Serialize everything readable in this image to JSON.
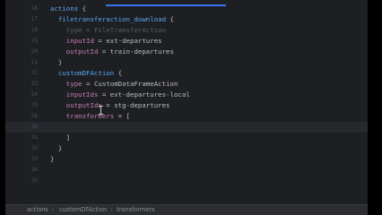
{
  "editor": {
    "lines": [
      {
        "num": "16",
        "indent": 0,
        "tokens": [
          {
            "t": "actions",
            "c": "prop"
          },
          {
            "t": " {",
            "c": "plain"
          }
        ]
      },
      {
        "num": "17",
        "indent": 1,
        "tokens": [
          {
            "t": "filetransferaction_download",
            "c": "prop"
          },
          {
            "t": " {",
            "c": "plain"
          }
        ]
      },
      {
        "num": "18",
        "indent": 2,
        "tokens": [
          {
            "t": "type = FileTransferAction",
            "c": "ghost"
          }
        ]
      },
      {
        "num": "19",
        "indent": 2,
        "tokens": [
          {
            "t": "inputId",
            "c": "key"
          },
          {
            "t": " = ext-departures",
            "c": "plain"
          }
        ]
      },
      {
        "num": "20",
        "indent": 2,
        "tokens": [
          {
            "t": "outputId",
            "c": "key"
          },
          {
            "t": " = train-departures",
            "c": "plain"
          }
        ]
      },
      {
        "num": "21",
        "indent": 1,
        "tokens": [
          {
            "t": "}",
            "c": "plain"
          }
        ]
      },
      {
        "num": "22",
        "indent": 1,
        "tokens": [
          {
            "t": "customDFAction",
            "c": "prop"
          },
          {
            "t": " {",
            "c": "plain"
          }
        ]
      },
      {
        "num": "23",
        "indent": 2,
        "tokens": [
          {
            "t": "type",
            "c": "key"
          },
          {
            "t": " = CustomDataFrameAction",
            "c": "plain"
          }
        ]
      },
      {
        "num": "24",
        "indent": 2,
        "tokens": [
          {
            "t": "inputIds",
            "c": "key"
          },
          {
            "t": " = ext-departures-local",
            "c": "plain"
          }
        ]
      },
      {
        "num": "25",
        "indent": 2,
        "tokens": [
          {
            "t": "outputIds",
            "c": "key"
          },
          {
            "t": " = stg-departures",
            "c": "plain"
          }
        ]
      },
      {
        "num": "26",
        "indent": 2,
        "tokens": [
          {
            "t": "transformers",
            "c": "key"
          },
          {
            "t": " = [",
            "c": "plain"
          }
        ]
      },
      {
        "num": "30",
        "indent": 3,
        "tokens": [],
        "current": true
      },
      {
        "num": "31",
        "indent": 2,
        "tokens": [
          {
            "t": "]",
            "c": "plain"
          }
        ]
      },
      {
        "num": "32",
        "indent": 1,
        "tokens": [
          {
            "t": "}",
            "c": "plain"
          }
        ]
      },
      {
        "num": "33",
        "indent": 0,
        "tokens": [
          {
            "t": "}",
            "c": "plain"
          }
        ]
      },
      {
        "num": "34",
        "indent": 0,
        "tokens": []
      },
      {
        "num": "35",
        "indent": 0,
        "tokens": []
      }
    ]
  },
  "breadcrumbs": [
    "actions",
    "customDFAction",
    "transformers"
  ],
  "breadcrumb_separator": "›",
  "colors": {
    "keyword": "#c77dbb",
    "property": "#56a8f5",
    "text": "#bcbec4",
    "progress": "#3574f0"
  }
}
